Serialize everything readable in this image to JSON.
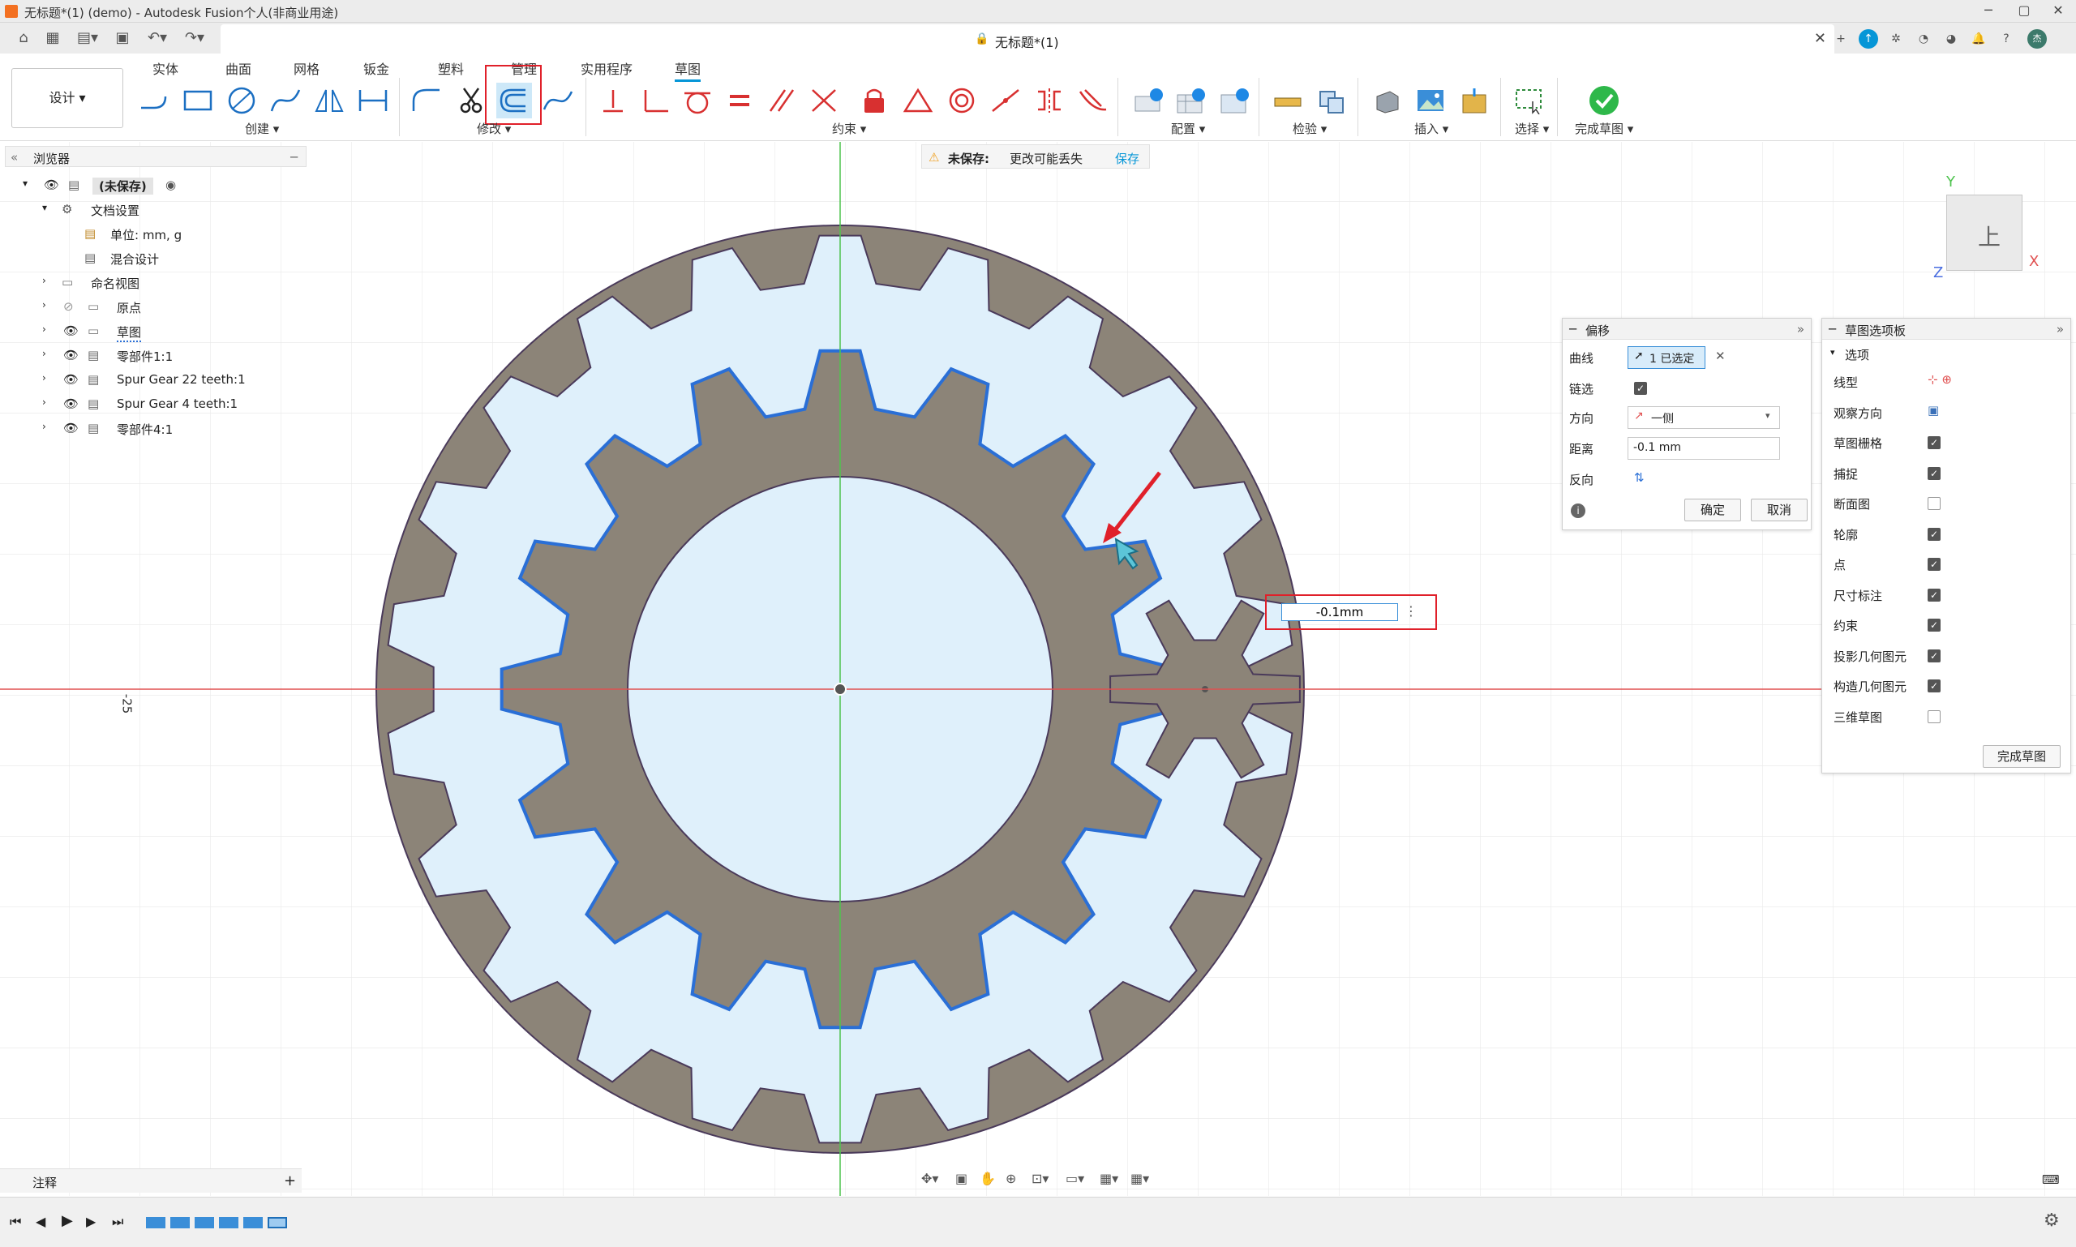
{
  "window": {
    "title": "无标题*(1) (demo) - Autodesk Fusion个人(非商业用途)",
    "doc_title": "无标题*(1)"
  },
  "ribbon": {
    "workspace": "设计 ▾",
    "tabs": [
      "实体",
      "曲面",
      "网格",
      "钣金",
      "塑料",
      "管理",
      "实用程序",
      "草图"
    ],
    "active_tab": "草图",
    "groups": {
      "create": "创建 ▾",
      "modify": "修改 ▾",
      "constraints": "约束 ▾",
      "configure": "配置 ▾",
      "inspect": "检验 ▾",
      "insert": "插入 ▾",
      "select": "选择 ▾",
      "finish": "完成草图 ▾"
    }
  },
  "browser": {
    "title": "浏览器",
    "root": "(未保存)",
    "items": [
      {
        "label": "文档设置"
      },
      {
        "label": "单位: mm, g"
      },
      {
        "label": "混合设计"
      },
      {
        "label": "命名视图"
      },
      {
        "label": "原点"
      },
      {
        "label": "草图"
      },
      {
        "label": "零部件1:1"
      },
      {
        "label": "Spur Gear 22 teeth:1"
      },
      {
        "label": "Spur Gear 4 teeth:1"
      },
      {
        "label": "零部件4:1"
      }
    ]
  },
  "warning": {
    "label": "未保存:",
    "message": "更改可能丢失",
    "save": "保存"
  },
  "offset": {
    "title": "偏移",
    "curve_label": "曲线",
    "curve_value": "1 已选定",
    "chain_label": "链选",
    "direction_label": "方向",
    "direction_value": "一侧",
    "distance_label": "距离",
    "distance_value": "-0.1 mm",
    "flip_label": "反向",
    "ok": "确定",
    "cancel": "取消"
  },
  "palette": {
    "title": "草图选项板",
    "section": "选项",
    "rows": [
      {
        "label": "线型",
        "kind": "icon"
      },
      {
        "label": "观察方向",
        "kind": "icon"
      },
      {
        "label": "草图栅格",
        "checked": true
      },
      {
        "label": "捕捉",
        "checked": true
      },
      {
        "label": "断面图",
        "checked": false
      },
      {
        "label": "轮廓",
        "checked": true
      },
      {
        "label": "点",
        "checked": true
      },
      {
        "label": "尺寸标注",
        "checked": true
      },
      {
        "label": "约束",
        "checked": true
      },
      {
        "label": "投影几何图元",
        "checked": true
      },
      {
        "label": "构造几何图元",
        "checked": true
      },
      {
        "label": "三维草图",
        "checked": false
      }
    ],
    "finish": "完成草图"
  },
  "dimension_input": "-0.1mm",
  "axis_label": "-25",
  "viewcube": {
    "face": "上",
    "x": "X",
    "y": "Y",
    "z": "Z"
  },
  "bottom": {
    "comments": "注释",
    "comments_add": "+"
  },
  "colors": {
    "accent": "#0696d7",
    "gear_fill": "#8c8478",
    "sketch_fill": "#dff0fb",
    "offset_line": "#2a6fd6",
    "highlight_red": "#e0202a",
    "finish_green": "#2eb84a"
  }
}
